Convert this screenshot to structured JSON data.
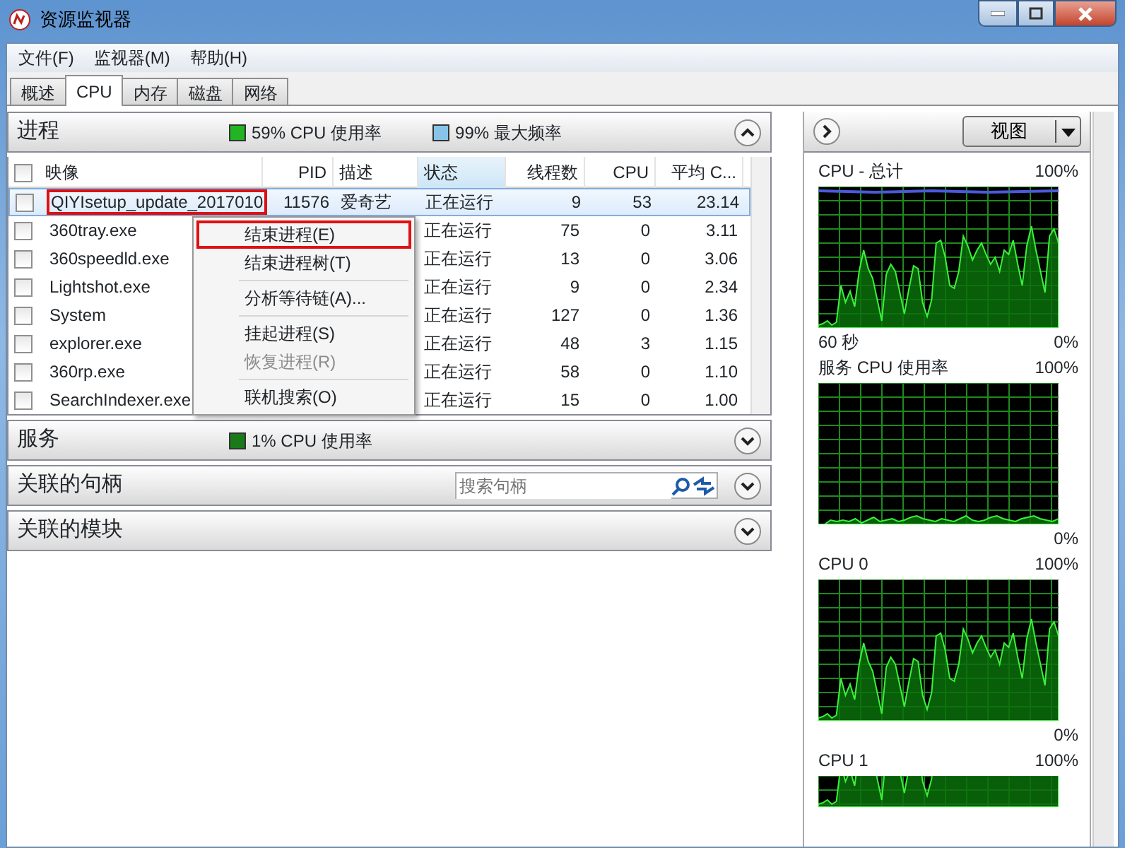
{
  "window": {
    "title": "资源监视器"
  },
  "menu": [
    "文件(F)",
    "监视器(M)",
    "帮助(H)"
  ],
  "tabs": [
    {
      "label": "概述",
      "selected": false
    },
    {
      "label": "CPU",
      "selected": true
    },
    {
      "label": "内存",
      "selected": false
    },
    {
      "label": "磁盘",
      "selected": false
    },
    {
      "label": "网络",
      "selected": false
    }
  ],
  "sections": [
    {
      "title": "进程",
      "expanded": true,
      "legend": [
        {
          "text": "59% CPU 使用率",
          "color": "#22b422"
        },
        {
          "text": "99% 最大频率",
          "color": "#88c4e8"
        }
      ]
    },
    {
      "title": "服务",
      "expanded": false,
      "legend": [
        {
          "text": "1% CPU 使用率",
          "color": "#1a7a1a"
        }
      ]
    },
    {
      "title": "关联的句柄",
      "expanded": false,
      "search": {
        "placeholder": "搜索句柄"
      }
    },
    {
      "title": "关联的模块",
      "expanded": false
    }
  ],
  "process_table": {
    "all_checked": false,
    "columns": [
      {
        "label": "映像",
        "sorted": false
      },
      {
        "label": "PID",
        "sorted": false
      },
      {
        "label": "描述",
        "sorted": false
      },
      {
        "label": "状态",
        "sorted": true
      },
      {
        "label": "线程数",
        "sorted": false
      },
      {
        "label": "CPU",
        "sorted": false
      },
      {
        "label": "平均 C...",
        "sorted": false
      }
    ],
    "rows": [
      {
        "checked": false,
        "selected": true,
        "highlighted": true,
        "cells": [
          "QIYIsetup_update_2017010",
          "11576",
          "爱奇艺",
          "正在运行",
          "9",
          "53",
          "23.14"
        ]
      },
      {
        "checked": false,
        "selected": false,
        "highlighted": false,
        "cells": [
          "360tray.exe",
          null,
          null,
          "正在运行",
          "75",
          "0",
          "3.11"
        ]
      },
      {
        "checked": false,
        "selected": false,
        "highlighted": false,
        "cells": [
          "360speedld.exe",
          null,
          null,
          "正在运行",
          "13",
          "0",
          "3.06"
        ]
      },
      {
        "checked": false,
        "selected": false,
        "highlighted": false,
        "cells": [
          "Lightshot.exe",
          null,
          null,
          "正在运行",
          "9",
          "0",
          "2.34"
        ]
      },
      {
        "checked": false,
        "selected": false,
        "highlighted": false,
        "cells": [
          "System",
          null,
          null,
          "正在运行",
          "127",
          "0",
          "1.36"
        ]
      },
      {
        "checked": false,
        "selected": false,
        "highlighted": false,
        "cells": [
          "explorer.exe",
          null,
          null,
          "正在运行",
          "48",
          "3",
          "1.15"
        ]
      },
      {
        "checked": false,
        "selected": false,
        "highlighted": false,
        "cells": [
          "360rp.exe",
          null,
          null,
          "正在运行",
          "58",
          "0",
          "1.10"
        ]
      },
      {
        "checked": false,
        "selected": false,
        "highlighted": false,
        "cells": [
          "SearchIndexer.exe",
          null,
          null,
          "正在运行",
          "15",
          "0",
          "1.00"
        ]
      }
    ]
  },
  "context_menu": [
    {
      "kind": "item",
      "label": "结束进程(E)",
      "disabled": false,
      "highlighted": true
    },
    {
      "kind": "item",
      "label": "结束进程树(T)",
      "disabled": false,
      "highlighted": false
    },
    {
      "kind": "separator"
    },
    {
      "kind": "item",
      "label": "分析等待链(A)...",
      "disabled": false,
      "highlighted": false
    },
    {
      "kind": "separator"
    },
    {
      "kind": "item",
      "label": "挂起进程(S)",
      "disabled": false,
      "highlighted": false
    },
    {
      "kind": "item",
      "label": "恢复进程(R)",
      "disabled": true,
      "highlighted": false
    },
    {
      "kind": "separator"
    },
    {
      "kind": "item",
      "label": "联机搜索(O)",
      "disabled": false,
      "highlighted": false
    }
  ],
  "right_panel": {
    "view_button": "视图",
    "graphs": [
      {
        "title": "CPU - 总计",
        "max_label": "100%",
        "time_label": "60 秒",
        "min_label": "0%",
        "kind": "busy",
        "frequency_line": true
      },
      {
        "title": "服务 CPU 使用率",
        "max_label": "100%",
        "min_label": "0%",
        "kind": "idle",
        "frequency_line": false
      },
      {
        "title": "CPU 0",
        "max_label": "100%",
        "min_label": "0%",
        "kind": "busy",
        "frequency_line": false
      },
      {
        "title": "CPU 1",
        "max_label": "100%",
        "kind": "cut",
        "frequency_line": false
      }
    ]
  }
}
